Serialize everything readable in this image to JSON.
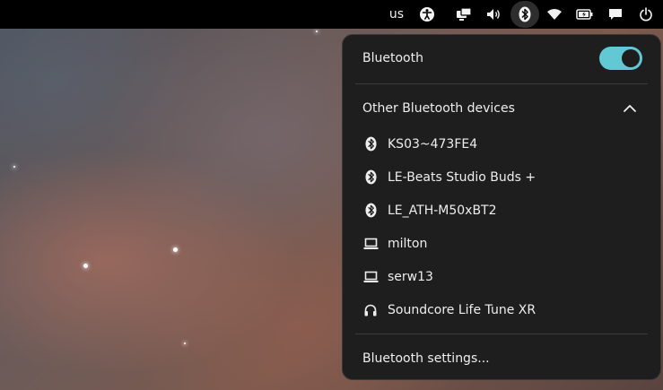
{
  "topbar": {
    "keyboard_layout": "us",
    "icons": [
      "accessibility-icon",
      "display-icon",
      "volume-icon",
      "bluetooth-icon",
      "wifi-icon",
      "battery-icon",
      "chat-icon",
      "power-icon"
    ]
  },
  "bluetooth_panel": {
    "title": "Bluetooth",
    "enabled": true,
    "accent_color": "#62c8d4",
    "devices_header": "Other Bluetooth devices",
    "devices": [
      {
        "name": "KS03~473FE4",
        "icon": "bluetooth-icon"
      },
      {
        "name": "LE-Beats Studio Buds +",
        "icon": "bluetooth-icon"
      },
      {
        "name": "LE_ATH-M50xBT2",
        "icon": "bluetooth-icon"
      },
      {
        "name": "milton",
        "icon": "laptop-icon"
      },
      {
        "name": "serw13",
        "icon": "laptop-icon"
      },
      {
        "name": "Soundcore Life Tune XR",
        "icon": "headphones-icon"
      }
    ],
    "settings_label": "Bluetooth settings..."
  }
}
